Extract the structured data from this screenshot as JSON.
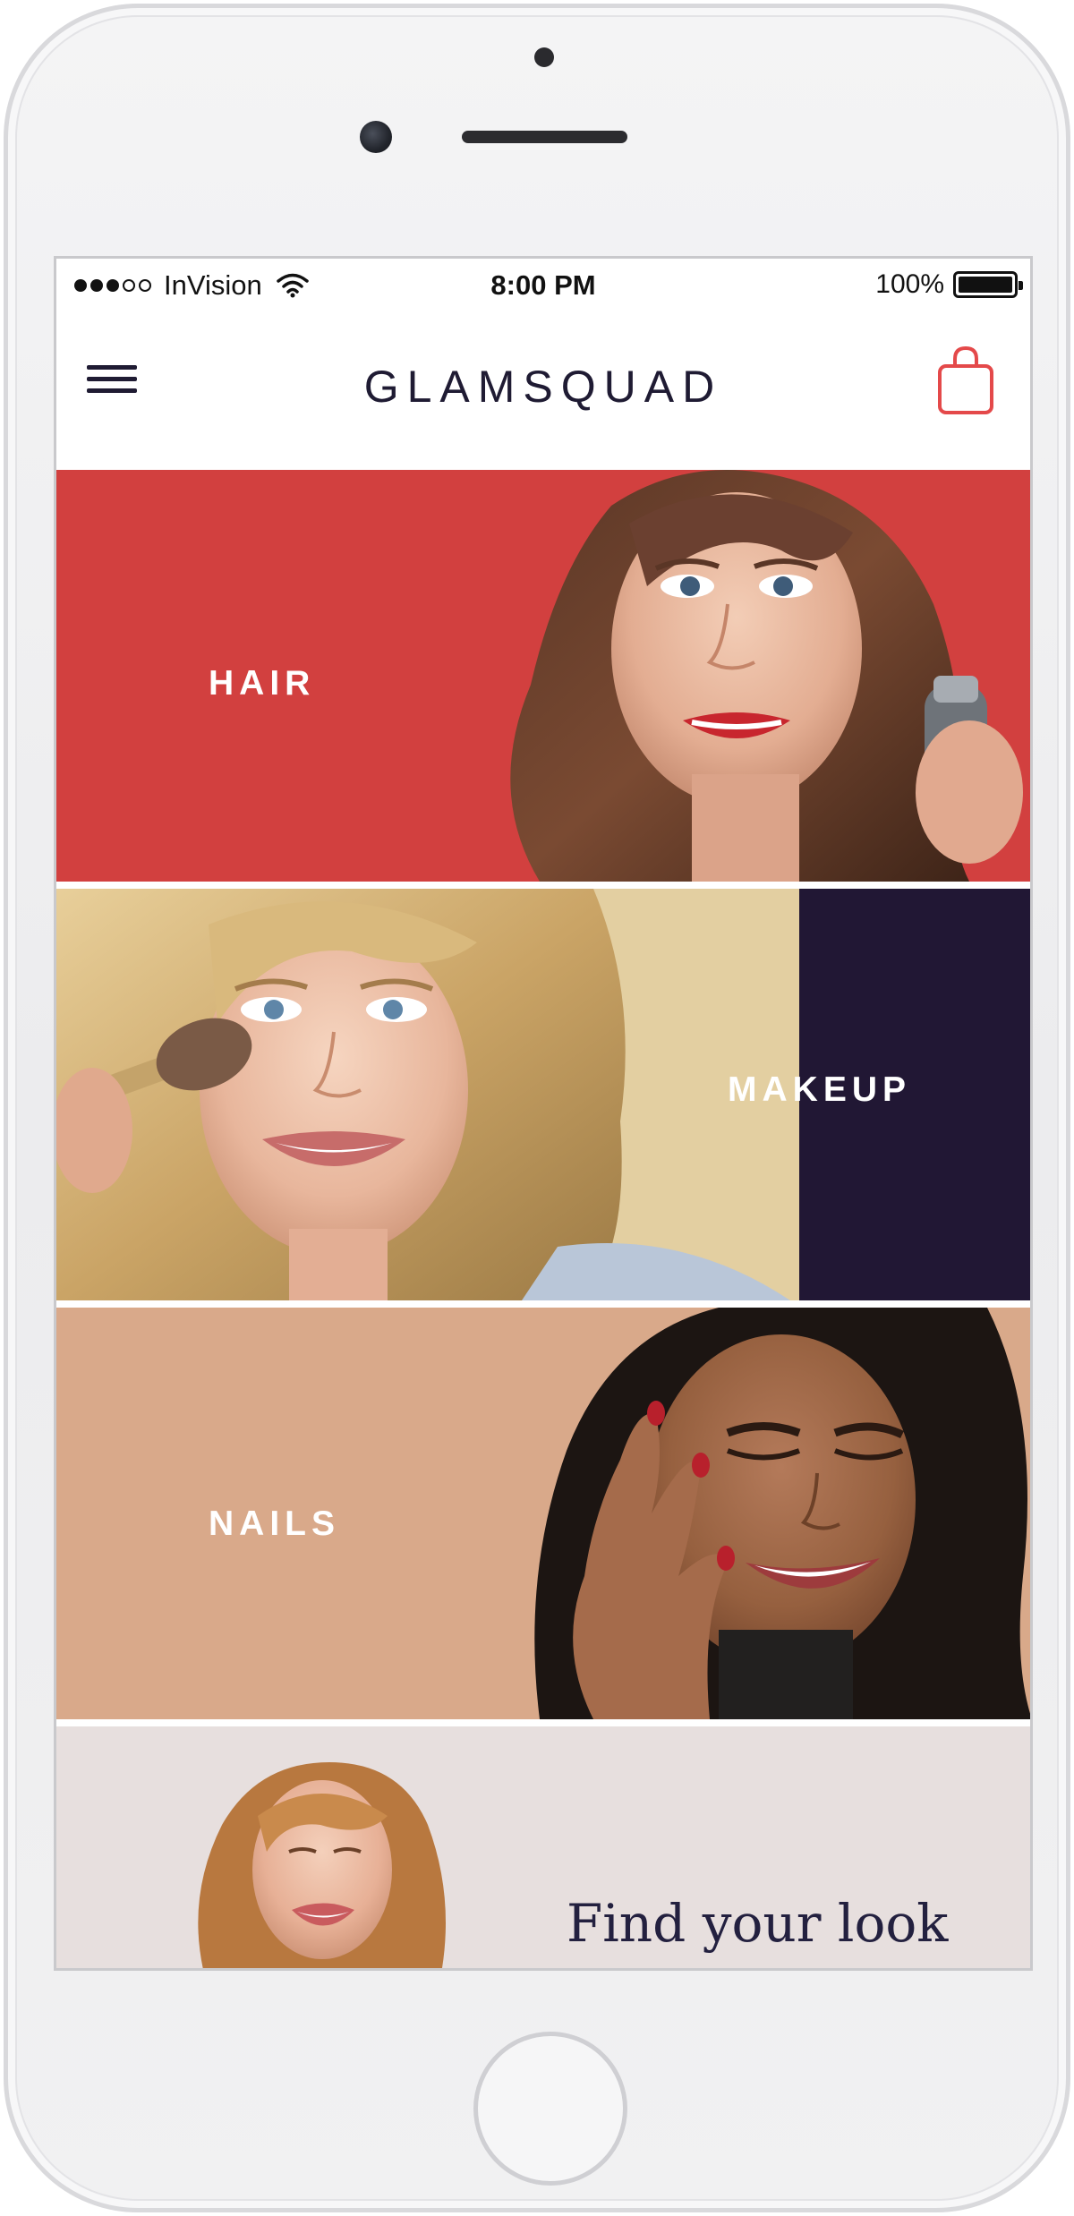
{
  "status_bar": {
    "carrier": "InVision",
    "time": "8:00 PM",
    "battery": "100%",
    "signal_icon": "signal-dots-icon",
    "wifi_icon": "wifi-icon",
    "battery_icon": "battery-icon"
  },
  "header": {
    "brand": "GLAMSQUAD",
    "menu_icon": "hamburger-menu-icon",
    "cart_icon": "shopping-bag-icon",
    "accent_color": "#e4494a"
  },
  "categories": [
    {
      "label": "HAIR",
      "color": "#d2403f"
    },
    {
      "label": "MAKEUP",
      "color": "#211734"
    },
    {
      "label": "NAILS",
      "color": "#d9a98a"
    }
  ],
  "promo": {
    "label": "Find your look",
    "color": "#e7dfde"
  }
}
